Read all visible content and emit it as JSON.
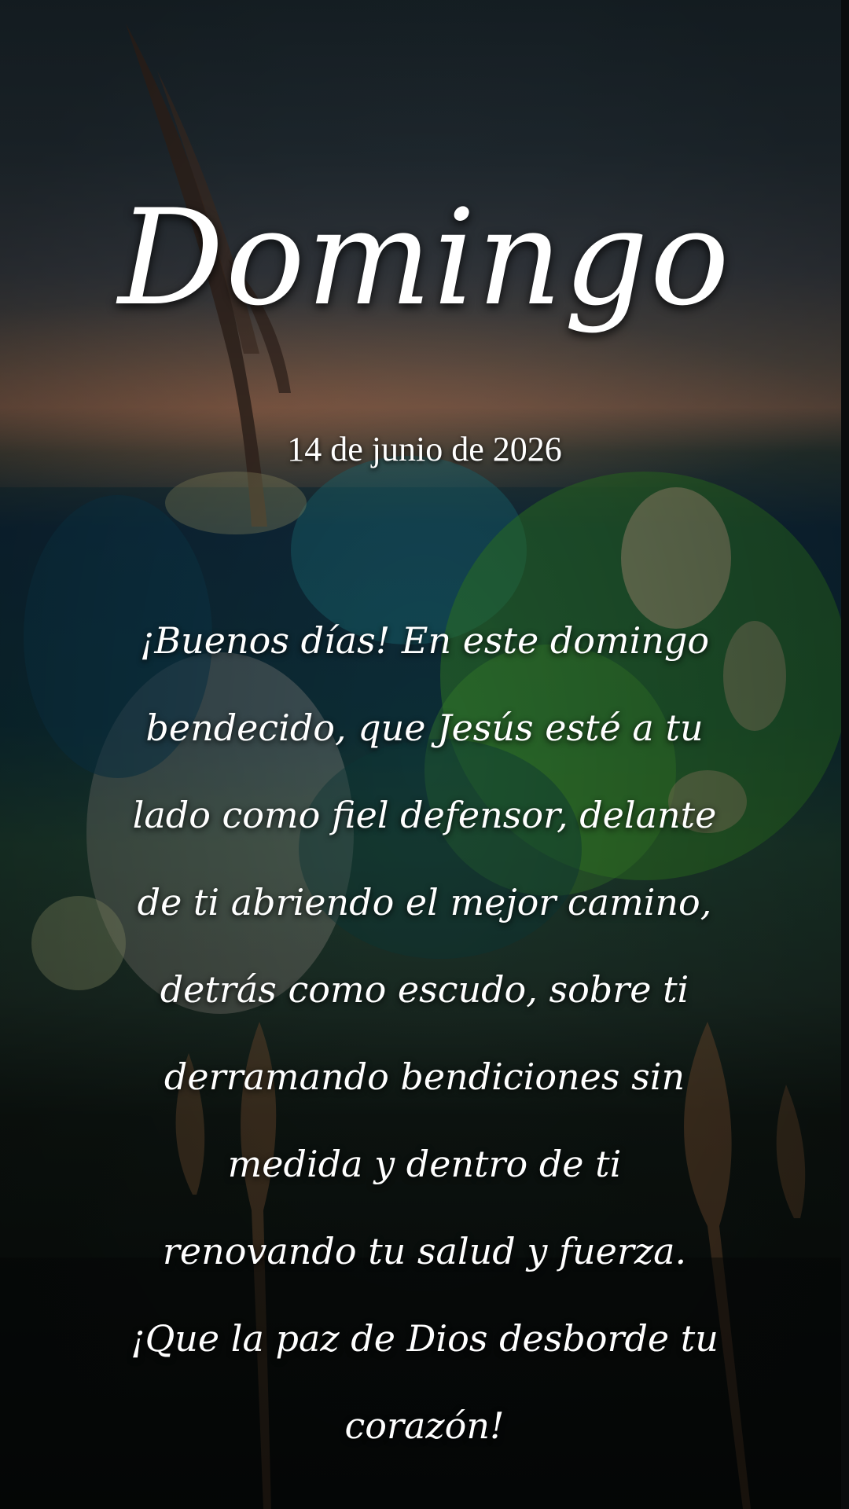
{
  "greeting_card": {
    "day": "Domingo",
    "date": "14 de junio de 2026",
    "message": "¡Buenos días! En este domingo bendecido, que Jesús esté a tu lado como fiel defensor, delante de ti abriendo el mejor camino, detrás como escudo, sobre ti derramando bendiciones sin medida y dentro de ti renovando tu salud y fuerza. ¡Que la paz de Dios desborde tu corazón!"
  },
  "colors": {
    "text": "#ffffff",
    "sky_top": "#1d2a31",
    "sunset": "#735a4b",
    "foliage_blue": "#0f2a3c",
    "foliage_green": "#2f6a2a",
    "ground_dark": "#070a09"
  }
}
